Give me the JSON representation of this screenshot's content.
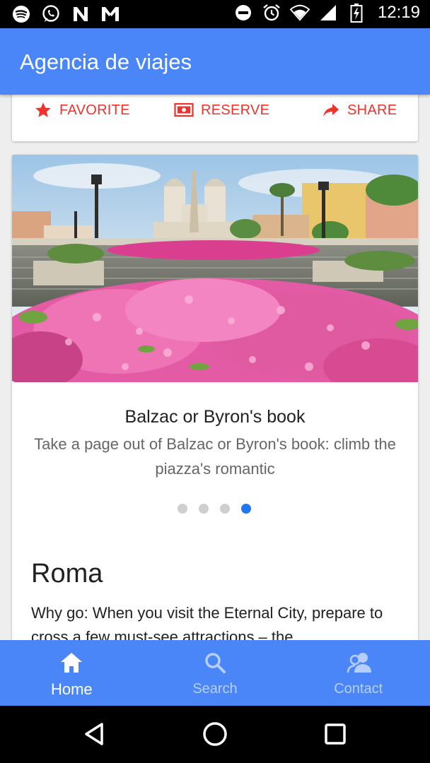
{
  "status_bar": {
    "time": "12:19",
    "left_icons": [
      "spotify-icon",
      "whatsapp-icon",
      "n-app-icon",
      "m-app-icon"
    ],
    "right_icons": [
      "do-not-disturb-icon",
      "alarm-icon",
      "wifi-icon",
      "signal-icon",
      "battery-icon"
    ]
  },
  "app_bar": {
    "title": "Agencia de viajes",
    "color": "#4a86f7"
  },
  "actions": {
    "favorite": {
      "label": "FAVORITE",
      "icon": "star-icon"
    },
    "reserve": {
      "label": "RESERVE",
      "icon": "ticket-icon"
    },
    "share": {
      "label": "SHARE",
      "icon": "share-arrow-icon"
    },
    "color": "#f0312c"
  },
  "carousel": {
    "image": "spanish-steps-azaleas-photo",
    "title": "Balzac or Byron's book",
    "description": "Take a page out of Balzac or Byron's book: climb the piazza's romantic",
    "active_index": 3,
    "count": 4
  },
  "section": {
    "title": "Roma",
    "text": "Why go: When you visit the Eternal City, prepare to cross a few must-see attractions – the"
  },
  "bottom_nav": {
    "items": [
      {
        "label": "Home",
        "icon": "home-icon",
        "active": true
      },
      {
        "label": "Search",
        "icon": "search-icon",
        "active": false
      },
      {
        "label": "Contact",
        "icon": "contacts-icon",
        "active": false
      }
    ]
  },
  "system_nav": [
    "back-icon",
    "home-circle-icon",
    "recents-icon"
  ]
}
